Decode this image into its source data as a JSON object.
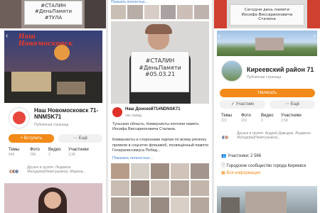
{
  "panel1": {
    "sign_top": "#СТАЛИН\n#ДеньПамяти\n#ТУЛА",
    "cover_title": "Наш Новомосковск",
    "group_name": "Наш Новомосковск 71-NNMSK71",
    "page_type": "Публичная страница",
    "join_button": "+ Вступить",
    "more_button": "Ещё",
    "stats": [
      {
        "label": "Темы",
        "value": "649"
      },
      {
        "label": "Фото",
        "value": "296"
      },
      {
        "label": "Видео",
        "value": "2"
      },
      {
        "label": "Участники",
        "value": "3,3K"
      }
    ],
    "friends_label": "Друзья в группе:",
    "friends_names": "Людмила Желудова(Никитушкина), Марина..."
  },
  "panel2": {
    "show_more_top": "Показать полностью...",
    "sign": "#СТАЛИН\n#ДеньПамяти\n#05.03.21",
    "author": "Наш Донской71#NDNSK71",
    "time": "час назад",
    "post_text": "Тульская область. Коммунисты почтили память Иосифа Виссарионовича Сталина.\n\nКоммунисты и сторонники партии по всему региону провели в соцсетях флешмоб, посвящённый памяти Генералиссимуса Побед...",
    "show_more": "Показать полностью..."
  },
  "panel3": {
    "sign_text": "Сегодня день памяти\nИосифа Виссарионовича\nСталина",
    "group_name": "Киреевский район 71",
    "page_type": "Публичная страница",
    "write_button": "Написать",
    "member_button": "✓ Участник",
    "more_button": "Ещё",
    "stats": [
      {
        "label": "Темы",
        "value": "221"
      },
      {
        "label": "Фото",
        "value": "222"
      },
      {
        "label": "Видео",
        "value": "3"
      },
      {
        "label": "Участники",
        "value": "2,5K"
      }
    ],
    "friends_label": "Друзья в группе:",
    "friends_names": "Андрей Давыдов, Людмила Желудова(Никитушкина)...",
    "members_line": "Участники: 2 566",
    "city_line": "Городское сообщество города Киреевск",
    "info_line": "Вся информация"
  }
}
